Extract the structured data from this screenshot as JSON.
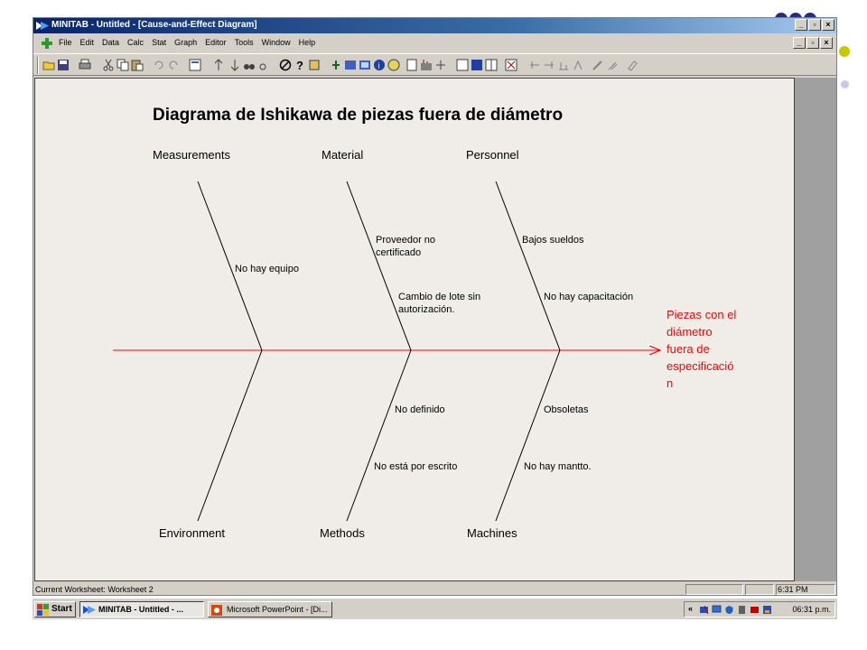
{
  "window": {
    "title": "MINITAB - Untitled - [Cause-and-Effect Diagram]",
    "controls": [
      "_",
      "\u0019",
      "×"
    ]
  },
  "menu": {
    "items": [
      "File",
      "Edit",
      "Data",
      "Calc",
      "Stat",
      "Graph",
      "Editor",
      "Tools",
      "Window",
      "Help"
    ]
  },
  "diagram": {
    "title": "Diagrama de Ishikawa de piezas fuera de diámetro",
    "effect": [
      "Piezas con el",
      "diámetro",
      "fuera de",
      "especificació",
      "n"
    ],
    "categories": {
      "top": [
        "Measurements",
        "Material",
        "Personnel"
      ],
      "bottom": [
        "Environment",
        "Methods",
        "Machines"
      ]
    },
    "causes": {
      "measurements": [
        "No hay equipo"
      ],
      "material": [
        [
          "Proveedor no",
          "certificado"
        ],
        [
          "Cambio de lote sin",
          "autorización."
        ]
      ],
      "personnel": [
        "Bajos sueldos",
        "No hay capacitación"
      ],
      "methods": [
        "No definido",
        "No está por escrito"
      ],
      "machines": [
        "Obsoletas",
        "No hay mantto."
      ]
    },
    "colors": {
      "effect": "#ff0000",
      "spine": "#ff0000",
      "bones": "#000000"
    }
  },
  "status": {
    "text": "Current Worksheet: Worksheet 2",
    "clock": "6:31 PM"
  },
  "taskbar": {
    "start_label": "Start",
    "tasks": [
      "MINITAB - Untitled - ...",
      "Microsoft PowerPoint - [Di..."
    ],
    "tray_time": "06:31 p.m.",
    "tray_prefix": "«"
  }
}
